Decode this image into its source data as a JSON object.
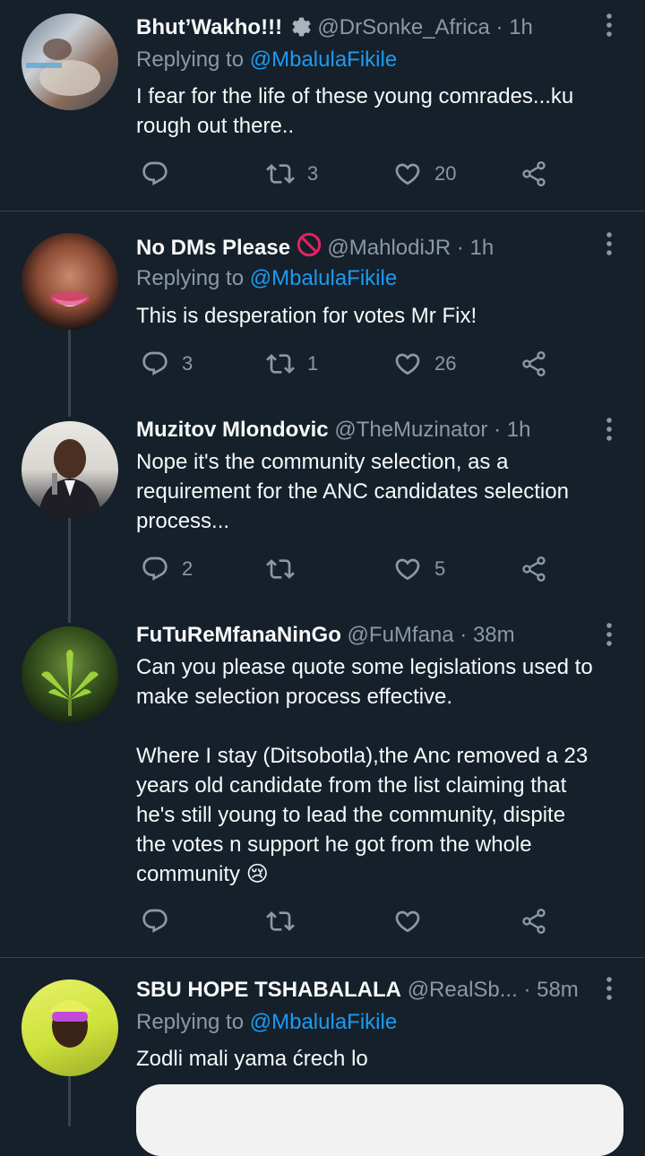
{
  "tweets": [
    {
      "name": "Bhut’Wakho!!!",
      "handle": "@DrSonke_Africa",
      "time": "· 1h",
      "replying_prefix": "Replying to ",
      "replying_to": "@MbalulaFikile",
      "text": "I fear for the life of these young comrades...ku\nrough out there..",
      "replies": "",
      "retweets": "3",
      "likes": "20"
    },
    {
      "name": "No DMs Please",
      "handle": "@MahlodiJR",
      "time": "· 1h",
      "replying_prefix": "Replying to ",
      "replying_to": "@MbalulaFikile",
      "text": "This is desperation for votes Mr Fix!",
      "replies": "3",
      "retweets": "1",
      "likes": "26"
    },
    {
      "name": "Muzitov Mlondovic",
      "handle": "@TheMuzinator",
      "time": "· 1h",
      "text": "Nope it's the community selection, as a\nrequirement for the ANC candidates selection\nprocess...",
      "replies": "2",
      "retweets": "",
      "likes": "5"
    },
    {
      "name": "FuTuReMfanaNinGo",
      "handle": "@FuMfana",
      "time": "· 38m",
      "text": "Can you please quote some legislations used to\nmake selection process effective.\n\nWhere I stay (Ditsobotla),the Anc removed a 23\nyears old candidate from the list claiming that\nhe's still young to lead the community, dispite\nthe votes n support he got from the whole\ncommunity 😢",
      "replies": "",
      "retweets": "",
      "likes": ""
    },
    {
      "name": "SBU HOPE TSHABALALA",
      "handle": "@RealSb...",
      "time": "· 58m",
      "replying_prefix": "Replying to ",
      "replying_to": "@MbalulaFikile",
      "text": "Zodli mali yama ćrech lo"
    }
  ],
  "icons": {
    "reply": "reply-icon",
    "retweet": "retweet-icon",
    "like": "heart-icon",
    "share": "share-icon",
    "more": "more-vertical-icon",
    "badge_gear": "gear-icon",
    "badge_no_entry": "no-entry-icon"
  },
  "colors": {
    "background": "#15202b",
    "text": "#f7f9f9",
    "muted": "#8b98a5",
    "link": "#1d9bf0",
    "divider": "#38444d",
    "no_entry": "#e0245e"
  }
}
